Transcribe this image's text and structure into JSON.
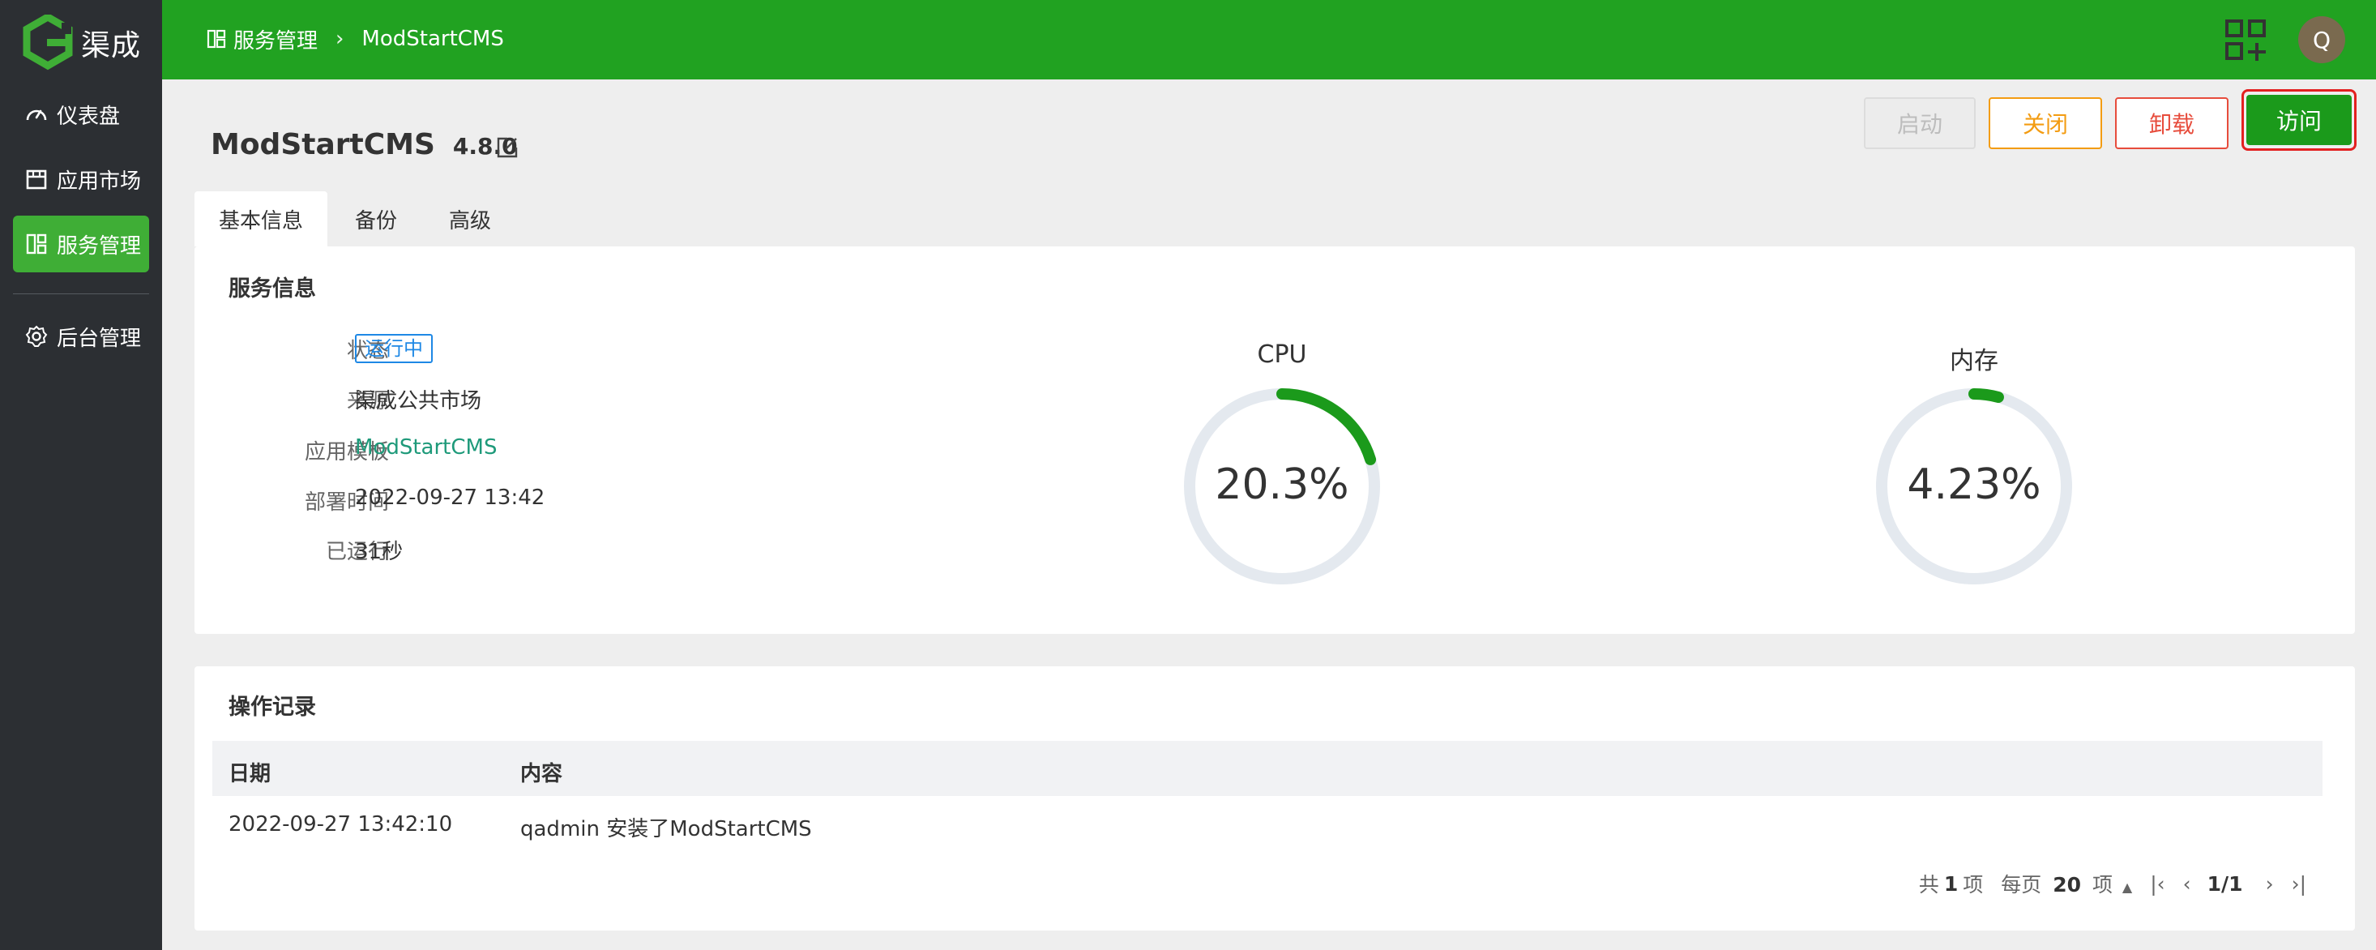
{
  "brand": {
    "name": "渠成",
    "accent": "#21a221",
    "sidebar_bg": "#2c2f33"
  },
  "sidebar": {
    "items": [
      {
        "label": "仪表盘",
        "icon": "gauge-icon"
      },
      {
        "label": "应用市场",
        "icon": "store-icon"
      },
      {
        "label": "服务管理",
        "icon": "grid-icon",
        "active": true
      },
      {
        "label": "后台管理",
        "icon": "gear-icon"
      }
    ]
  },
  "header": {
    "breadcrumb": [
      "服务管理",
      "ModStartCMS"
    ],
    "avatar_letter": "Q"
  },
  "service": {
    "name": "ModStartCMS",
    "version": "4.8.0"
  },
  "actions": {
    "start": "启动",
    "close": "关闭",
    "uninstall": "卸载",
    "visit": "访问"
  },
  "tabs": [
    "基本信息",
    "备份",
    "高级"
  ],
  "info": {
    "title": "服务信息",
    "rows": [
      {
        "label": "状态",
        "value": "运行中"
      },
      {
        "label": "来源",
        "value": "渠成公共市场"
      },
      {
        "label": "应用模板",
        "value": "ModStartCMS"
      },
      {
        "label": "部署时间",
        "value": "2022-09-27 13:42"
      },
      {
        "label": "已运行",
        "value": "31秒"
      }
    ]
  },
  "metrics": {
    "cpu": {
      "title": "CPU",
      "display": "20.3%",
      "percent": 20.3
    },
    "memory": {
      "title": "内存",
      "display": "4.23%",
      "percent": 4.23
    }
  },
  "log": {
    "title": "操作记录",
    "columns": [
      "日期",
      "内容"
    ],
    "rows": [
      {
        "date": "2022-09-27 13:42:10",
        "content": "qadmin 安装了ModStartCMS"
      }
    ],
    "pager": {
      "total_prefix": "共",
      "total": "1",
      "total_suffix": "项",
      "per_page_prefix": "每页",
      "per_page": "20",
      "per_page_suffix": "项",
      "page": "1/1"
    }
  }
}
